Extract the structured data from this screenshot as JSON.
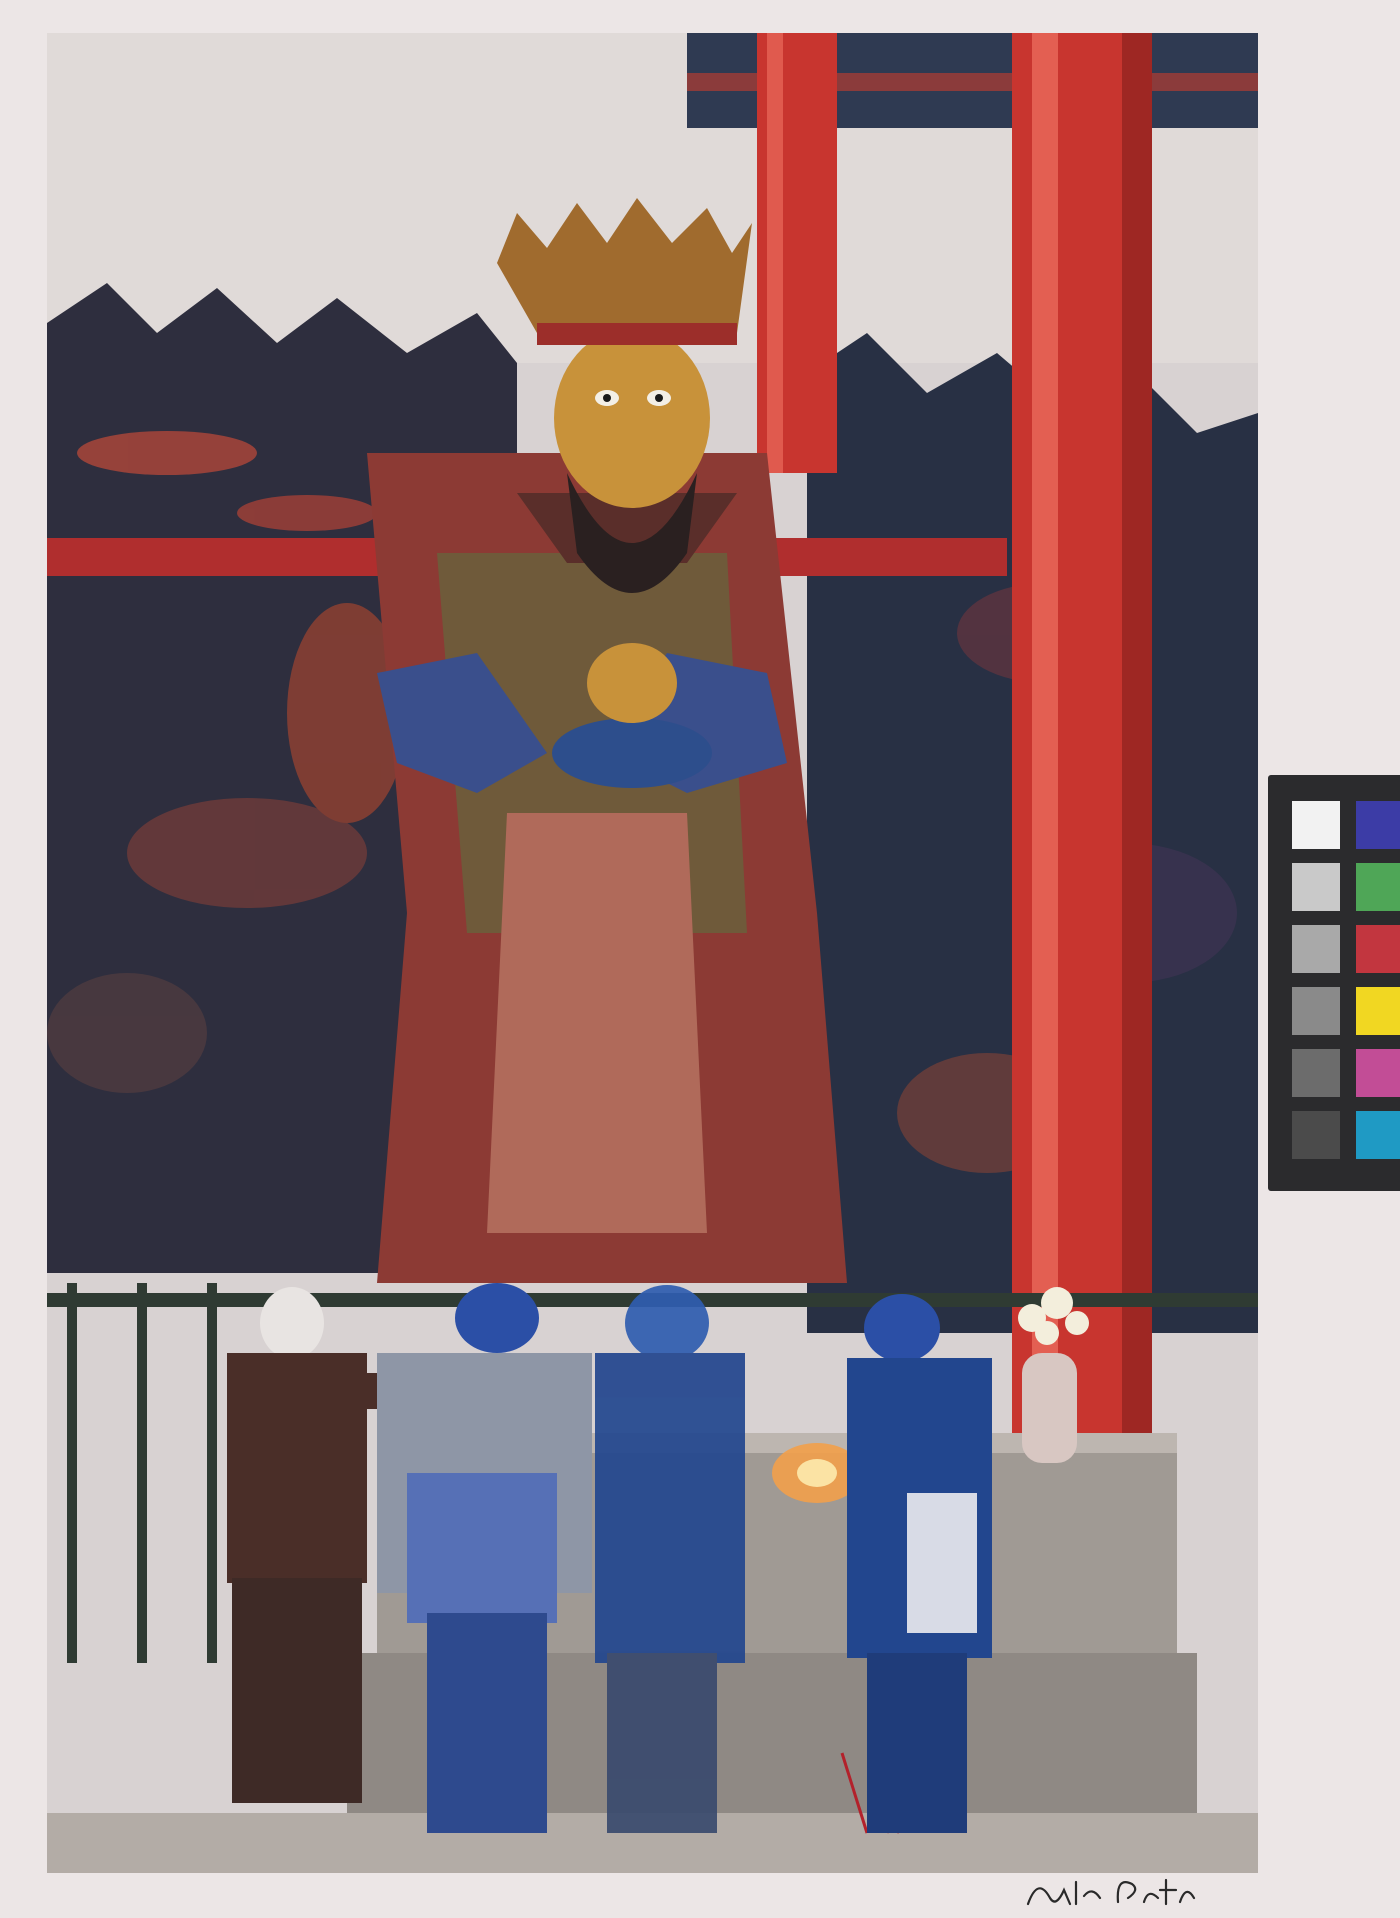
{
  "photograph": {
    "subject": "temple-guardian-statue"
  },
  "color_target": {
    "left_column": [
      "#f2f2f2",
      "#c9c9c9",
      "#a9a9a9",
      "#8a8a8a",
      "#6c6c6c",
      "#4b4b4b"
    ],
    "right_column": [
      "#3c3ca6",
      "#4fa657",
      "#c2363f",
      "#f1d722",
      "#c24d96",
      "#1f9ac4"
    ]
  },
  "signature": {
    "text": "Eliot Porter"
  },
  "colors": {
    "mount": "#ece6e6",
    "pillar_red": "#c8352f",
    "robe_blue": "#1f3f8c",
    "gold": "#c8923a"
  }
}
